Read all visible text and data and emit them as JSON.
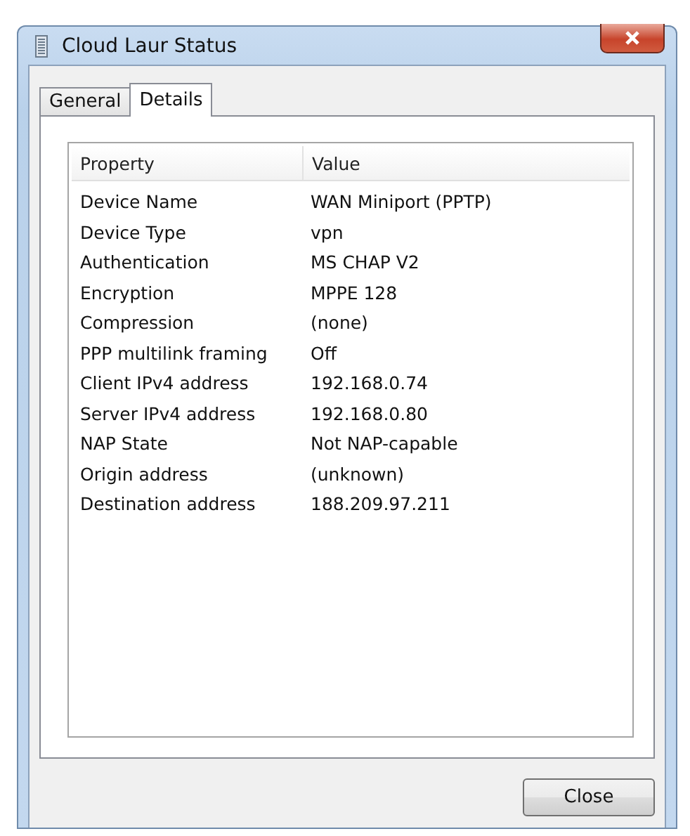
{
  "window": {
    "title": "Cloud Laur Status"
  },
  "tabs": [
    {
      "label": "General",
      "selected": false
    },
    {
      "label": "Details",
      "selected": true
    }
  ],
  "table": {
    "columns": [
      "Property",
      "Value"
    ],
    "rows": [
      [
        "Device Name",
        "WAN Miniport (PPTP)"
      ],
      [
        "Device Type",
        "vpn"
      ],
      [
        "Authentication",
        "MS CHAP V2"
      ],
      [
        "Encryption",
        "MPPE 128"
      ],
      [
        "Compression",
        "(none)"
      ],
      [
        "PPP multilink framing",
        "Off"
      ],
      [
        "Client IPv4 address",
        "192.168.0.74"
      ],
      [
        "Server IPv4 address",
        "192.168.0.80"
      ],
      [
        "NAP State",
        "Not NAP-capable"
      ],
      [
        "Origin address",
        "(unknown)"
      ],
      [
        "Destination address",
        "188.209.97.211"
      ]
    ]
  },
  "buttons": [
    "Close"
  ]
}
